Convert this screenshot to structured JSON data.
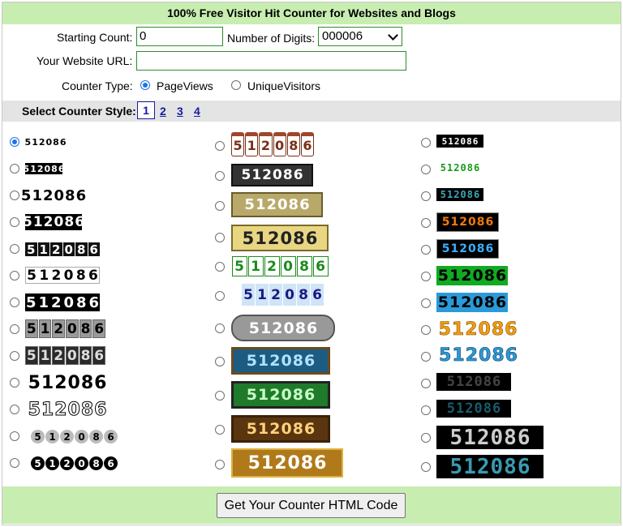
{
  "title": "100% Free Visitor Hit Counter for Websites and Blogs",
  "form": {
    "starting_count_label": "Starting Count:",
    "starting_count_value": "0",
    "digits_label": "Number of Digits:",
    "digits_value": "000006",
    "url_label": "Your Website URL:",
    "url_value": "",
    "counter_type_label": "Counter Type:",
    "type_options": [
      "PageViews",
      "UniqueVisitors"
    ],
    "type_selected": "PageViews"
  },
  "styles": {
    "label": "Select Counter Style:",
    "pages": [
      "1",
      "2",
      "3",
      "4"
    ],
    "current_page": "1",
    "sample_number": "512086",
    "selected_style": "column-1-row-1"
  },
  "button_label": "Get Your Counter HTML Code",
  "colors": {
    "header_green": "#c7edb0",
    "style_bar_gray": "#e4e4e4",
    "link_blue": "#1a1aa6",
    "radio_blue": "#1a73e8",
    "input_border": "#2e8b2e"
  }
}
